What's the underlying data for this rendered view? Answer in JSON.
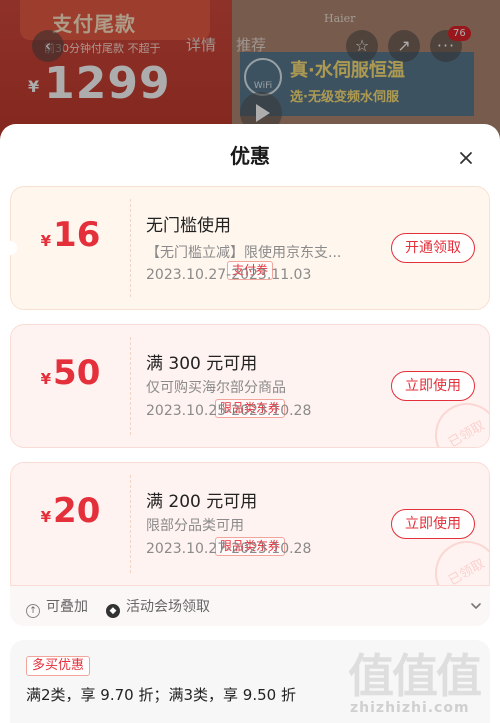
{
  "background_page": {
    "promo_title": "支付尾款",
    "promo_sub": "前30分钟付尾款 不超于",
    "price_currency": "¥",
    "price": "1299",
    "brand": "Haier",
    "tabs": [
      "详情",
      "推荐"
    ],
    "banner_line1": "真·水伺服恒温",
    "banner_line2": "选·无级变频水伺服",
    "wifi_label": "WiFi",
    "cart_badge": "76"
  },
  "sheet": {
    "title": "优惠"
  },
  "coupons": [
    {
      "currency": "¥",
      "amount": "16",
      "tag": "支付券",
      "title": "无门槛使用",
      "desc": "【无门槛立减】限使用京东支...",
      "date": "2023.10.27-2023.11.03",
      "button": "开通领取"
    },
    {
      "currency": "¥",
      "amount": "50",
      "tag": "限品类东券",
      "title": "满 300 元可用",
      "desc": "仅可购买海尔部分商品",
      "date": "2023.10.25-2023.10.28",
      "button": "立即使用",
      "stamp": "已领取"
    },
    {
      "currency": "¥",
      "amount": "20",
      "tag": "限品类东券",
      "title": "满 200 元可用",
      "desc": "限部分品类可用",
      "date": "2023.10.27-2023.10.28",
      "button": "立即使用",
      "stamp": "已领取"
    }
  ],
  "coupon_meta": {
    "stackable": "可叠加",
    "source": "活动会场领取"
  },
  "multi_buy": {
    "badge": "多买优惠",
    "text": "满2类，享 9.70 折；满3类，享 9.50 折"
  },
  "watermark": {
    "glyphs": "值值值",
    "url": "zhizhizhi.com"
  },
  "colors": {
    "accent": "#e4303b",
    "coupon_bg_orange": "#fff6ee",
    "coupon_bg_pink": "#fff3f1"
  }
}
